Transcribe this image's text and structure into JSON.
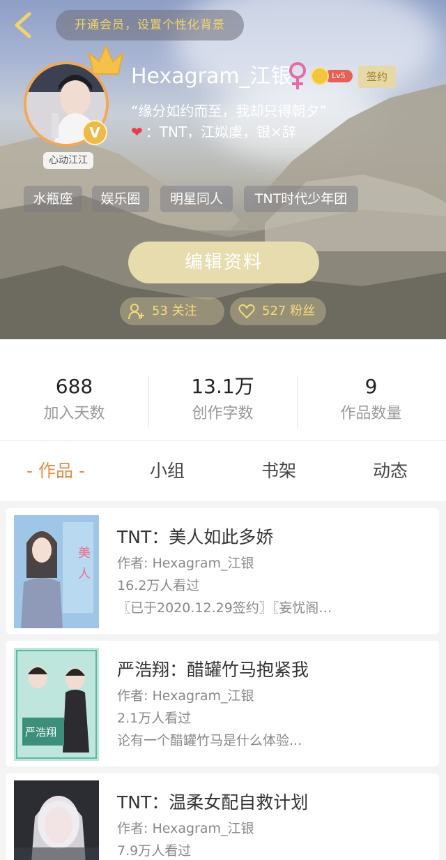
{
  "header": {
    "vip_prompt": "开通会员，设置个性化背景",
    "avatar_nickname": "心动江江",
    "verified_mark": "V",
    "username": "Hexagram_江银",
    "level": "Lv5",
    "signed_label": "签约",
    "bio": "“缘分如约而至，我却只得朝夕”",
    "favorites": "：TNT，江姒虞，银×辞",
    "tags": [
      "水瓶座",
      "娱乐圈",
      "明星同人",
      "TNT时代少年团"
    ],
    "edit_button": "编辑资料",
    "following": "53 关注",
    "fans": "527 粉丝"
  },
  "stats": [
    {
      "value": "688",
      "label": "加入天数"
    },
    {
      "value": "13.1万",
      "label": "创作字数"
    },
    {
      "value": "9",
      "label": "作品数量"
    }
  ],
  "tabs": [
    "- 作品 -",
    "小组",
    "书架",
    "动态"
  ],
  "works": [
    {
      "title": "TNT：美人如此多娇",
      "author": "作者: Hexagram_江银",
      "views": "16.2万人看过",
      "desc": "〖已于2020.12.29签约〗〖妄忧阁…"
    },
    {
      "title": "严浩翔：醋罐竹马抱紧我",
      "author": "作者: Hexagram_江银",
      "views": "2.1万人看过",
      "desc": "论有一个醋罐竹马是什么体验..."
    },
    {
      "title": "TNT：温柔女配自救计划",
      "author": "作者: Hexagram_江银",
      "views": "7.9万人看过",
      "desc": ""
    }
  ],
  "colors": {
    "accent": "#e58c4a",
    "gold": "#f3d46a",
    "level_red": "#e85f55"
  }
}
